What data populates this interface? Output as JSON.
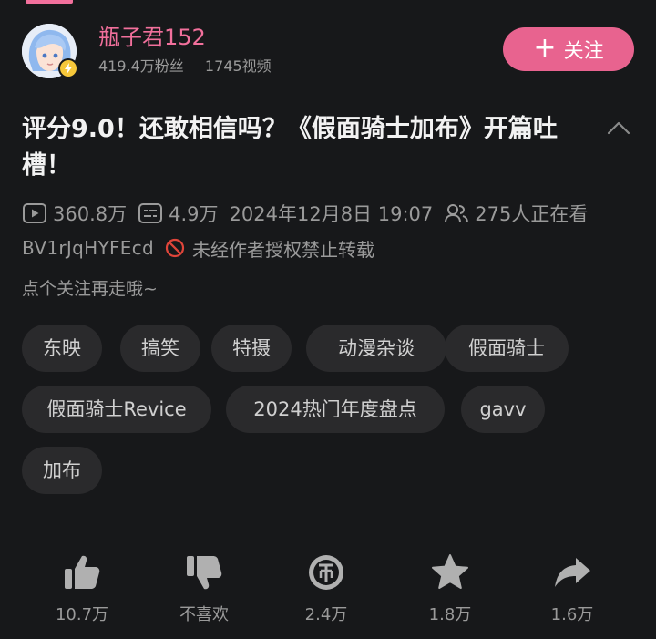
{
  "uploader": {
    "name": "瓶子君152",
    "fans": "419.4万粉丝",
    "videos": "1745视频",
    "follow_label": "关注",
    "follow_plus": "+"
  },
  "video": {
    "title": "评分9.0！还敢相信吗？《假面骑士加布》开篇吐槽！",
    "views": "360.8万",
    "danmaku": "4.9万",
    "date": "2024年12月8日 19:07",
    "watching": "275人正在看",
    "bvid": "BV1rJqHYFEcd",
    "copyright": "未经作者授权禁止转载",
    "description": "点个关注再走哦~"
  },
  "tags": [
    "东映",
    "搞笑",
    "特摄",
    "动漫杂谈",
    "假面骑士",
    "假面骑士Revice",
    "2024热门年度盘点",
    "gavv",
    "加布"
  ],
  "actions": {
    "like": "10.7万",
    "dislike": "不喜欢",
    "coin": "2.4万",
    "favorite": "1.8万",
    "share": "1.6万"
  },
  "colors": {
    "accent": "#e8638f",
    "name_pink": "#f2709c",
    "background": "#17181a",
    "tag_bg": "#2a2a2c",
    "muted": "#9a9a9a",
    "badge": "#f6c73a",
    "warning": "#e0453a"
  },
  "icons": [
    "play-count-icon",
    "danmaku-icon",
    "watching-icon",
    "no-reprint-icon",
    "collapse-icon",
    "like-icon",
    "dislike-icon",
    "coin-icon",
    "favorite-icon",
    "share-icon",
    "verify-badge-icon"
  ]
}
